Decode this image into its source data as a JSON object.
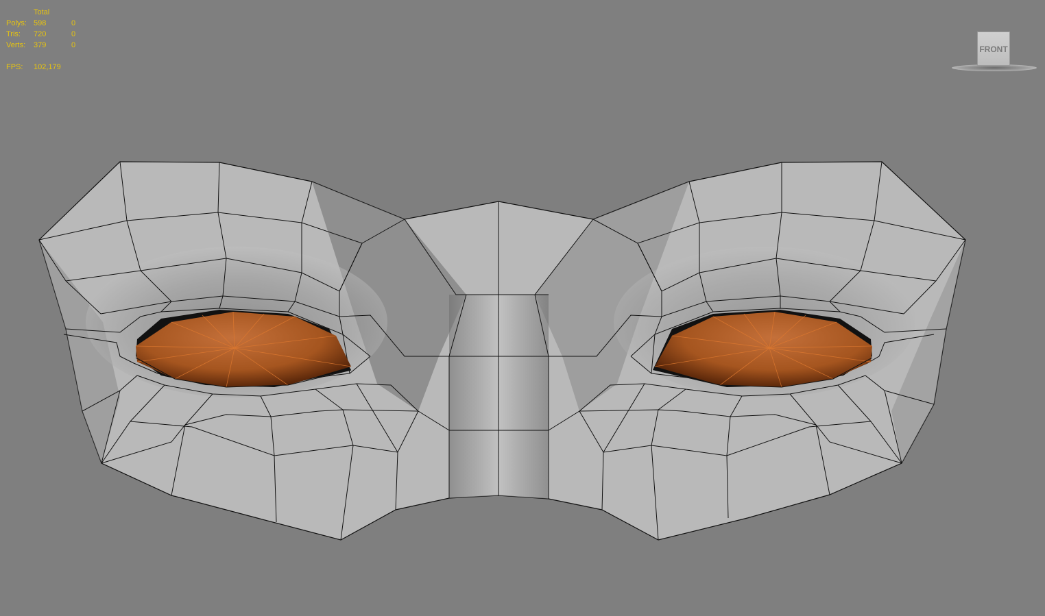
{
  "stats": {
    "header": "Total",
    "rows": [
      {
        "label": "Polys:",
        "total": "598",
        "selected": "0"
      },
      {
        "label": "Tris:",
        "total": "720",
        "selected": "0"
      },
      {
        "label": "Verts:",
        "total": "379",
        "selected": "0"
      }
    ],
    "fps_label": "FPS:",
    "fps_value": "102,179"
  },
  "viewcube": {
    "face_label": "FRONT"
  },
  "colors": {
    "background": "#7f7f7f",
    "stats_text": "#e8c40f",
    "mesh_surface": "#b8b8b8",
    "eyeball": "#b8622a",
    "wire": "#111111"
  }
}
